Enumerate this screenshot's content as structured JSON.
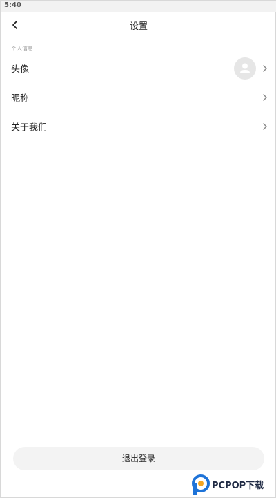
{
  "status_bar": {
    "time": "5:40"
  },
  "header": {
    "title": "设置"
  },
  "sections": [
    {
      "label": "个人信息",
      "items": [
        {
          "label": "头像",
          "icon": "avatar"
        },
        {
          "label": "昵称"
        },
        {
          "label": "关于我们"
        }
      ]
    }
  ],
  "logout_label": "退出登录",
  "watermark": {
    "logo_text": "PCPOP下载"
  },
  "colors": {
    "background": "#ffffff",
    "status_bar": "#f2f2f2",
    "section_label": "#9a9a9a",
    "avatar_bg": "#e6e6e6",
    "logout_bg": "#f3f3f3",
    "watermark_blue": "#1e73d8"
  }
}
